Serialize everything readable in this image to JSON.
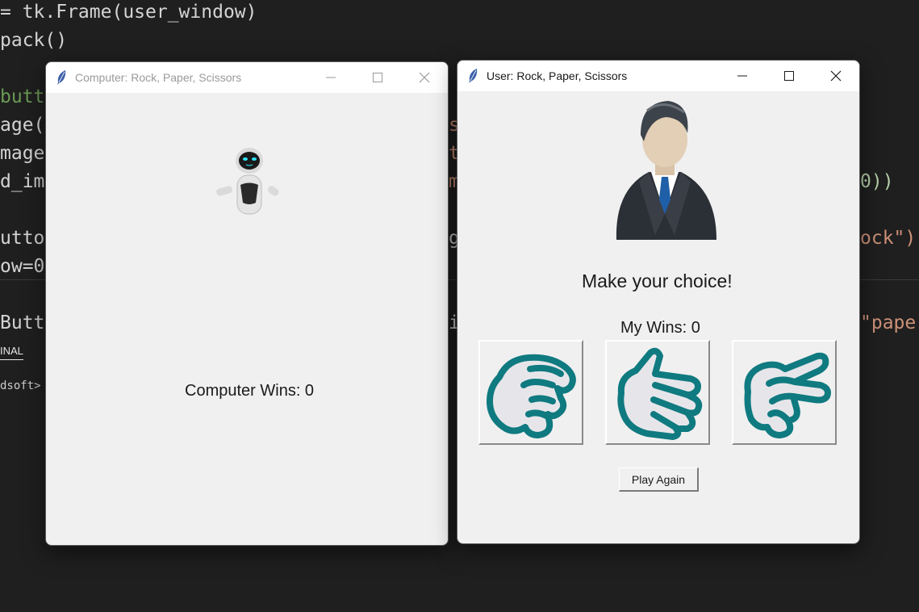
{
  "editor": {
    "lines": [
      "= tk.Frame(user_window)",
      "pack()",
      "butt",
      "age(",
      "mage",
      "d_im",
      "utto",
      "ow=0",
      "Butt"
    ],
    "right_fragments": [
      "0))",
      "ock\")",
      "\"pape"
    ],
    "middle_fragments": [
      "s",
      "ts",
      "m",
      "g,",
      "im"
    ],
    "terminal_tab": "INAL",
    "terminal_prompt": "dsoft>"
  },
  "computer_window": {
    "title": "Computer: Rock, Paper, Scissors",
    "title_icon": "feather-icon",
    "avatar_icon": "robot-icon",
    "wins_label": "Computer Wins: 0"
  },
  "user_window": {
    "title": "User: Rock, Paper, Scissors",
    "title_icon": "feather-icon",
    "avatar_icon": "businessman-icon",
    "prompt": "Make your choice!",
    "wins_label": "My Wins: 0",
    "choices": [
      {
        "name": "rock",
        "icon": "rock-hand-icon"
      },
      {
        "name": "paper",
        "icon": "paper-hand-icon"
      },
      {
        "name": "scissors",
        "icon": "scissors-hand-icon"
      }
    ],
    "play_again_label": "Play Again"
  },
  "colors": {
    "hand_outline": "#0f7a80",
    "hand_fill": "#e6e6ea",
    "window_bg": "#f0f0f0",
    "editor_bg": "#1f1f1f"
  }
}
